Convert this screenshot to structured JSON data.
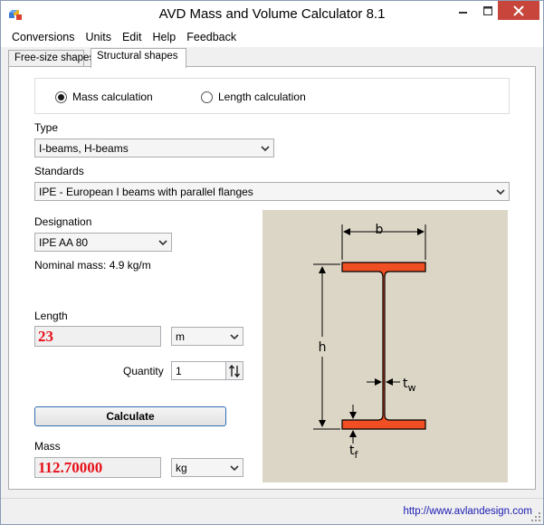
{
  "window": {
    "title": "AVD Mass and Volume Calculator 8.1"
  },
  "menu": [
    "Conversions",
    "Units",
    "Edit",
    "Help",
    "Feedback"
  ],
  "tabs": [
    "Free-size shapes",
    "Structural shapes"
  ],
  "active_tab": "Structural shapes",
  "radios": {
    "mass": "Mass calculation",
    "length": "Length calculation",
    "selected": "mass"
  },
  "type": {
    "label": "Type",
    "value": "I-beams, H-beams"
  },
  "standards": {
    "label": "Standards",
    "value": "IPE - European I beams with parallel flanges"
  },
  "designation": {
    "label": "Designation",
    "value": "IPE AA 80"
  },
  "nominal_mass": "Nominal mass: 4.9 kg/m",
  "length": {
    "label": "Length",
    "value": "23",
    "unit": "m"
  },
  "quantity": {
    "label": "Quantity",
    "value": "1"
  },
  "calculate_label": "Calculate",
  "mass": {
    "label": "Mass",
    "value": "112.70000",
    "unit": "kg"
  },
  "diagram": {
    "b": "b",
    "h": "h",
    "tw": "t",
    "tw_sub": "w",
    "tf": "t",
    "tf_sub": "f"
  },
  "status": {
    "url": "http://www.avlandesign.com"
  },
  "colors": {
    "beam": "#f04e23",
    "diagram_bg": "#dcd6c6",
    "value_text": "#e8101a",
    "close_button": "#c7453a"
  }
}
